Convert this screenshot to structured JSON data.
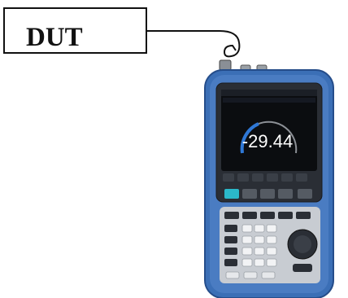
{
  "dut": {
    "label": "DUT"
  },
  "instrument": {
    "reading": "-29.44",
    "colors": {
      "frame": "#3b6fb6",
      "frame_dark": "#254d8a",
      "bezel": "#2a2e35",
      "screen": "#0b0d10",
      "arc_blue": "#2f78d6",
      "keypad": "#c8ccd2",
      "accent_key": "#2bb8c9"
    }
  }
}
